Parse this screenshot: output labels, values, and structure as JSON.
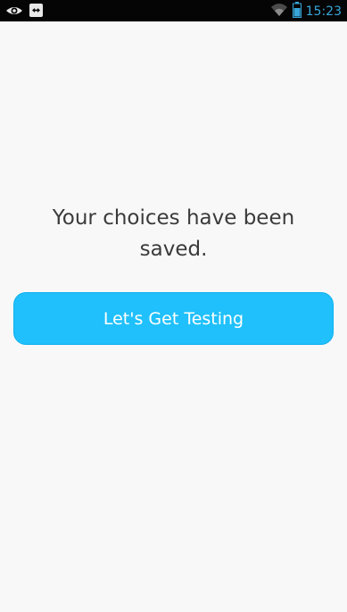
{
  "status_bar": {
    "time": "15:23",
    "icons": [
      "eye-icon",
      "remote-control-icon",
      "wifi-icon",
      "battery-icon"
    ],
    "accent_color": "#38a6d9"
  },
  "message": {
    "line1": "Your choices have been",
    "line2": "saved."
  },
  "cta": {
    "label": "Let's Get Testing",
    "color": "#1fc0fb"
  }
}
